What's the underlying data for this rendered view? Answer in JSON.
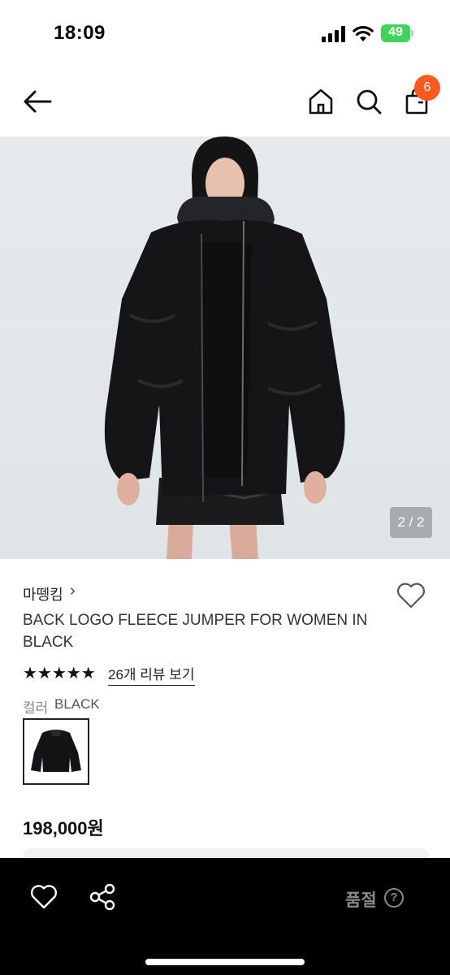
{
  "status_bar": {
    "time": "18:09",
    "battery": "49"
  },
  "nav": {
    "cart_count": "6"
  },
  "gallery": {
    "counter": "2 / 2"
  },
  "product": {
    "brand": "마뗑킴",
    "brand_chevron": "›",
    "title": "BACK LOGO FLEECE JUMPER FOR WOMEN IN BLACK",
    "stars": "★★★★★",
    "review_link": "26개 리뷰 보기",
    "color_label": "컬러",
    "color_value": "BLACK",
    "price": "198,000원"
  },
  "bottom_bar": {
    "status": "품절",
    "help": "?"
  },
  "colors": {
    "badge": "#ff5a1f",
    "battery": "#3fd35c",
    "bottom_bar": "#000000",
    "image_bg": "#e4e8ea"
  },
  "icons": [
    "back-arrow-icon",
    "home-icon",
    "search-icon",
    "cart-icon",
    "heart-icon",
    "share-icon",
    "help-icon"
  ]
}
